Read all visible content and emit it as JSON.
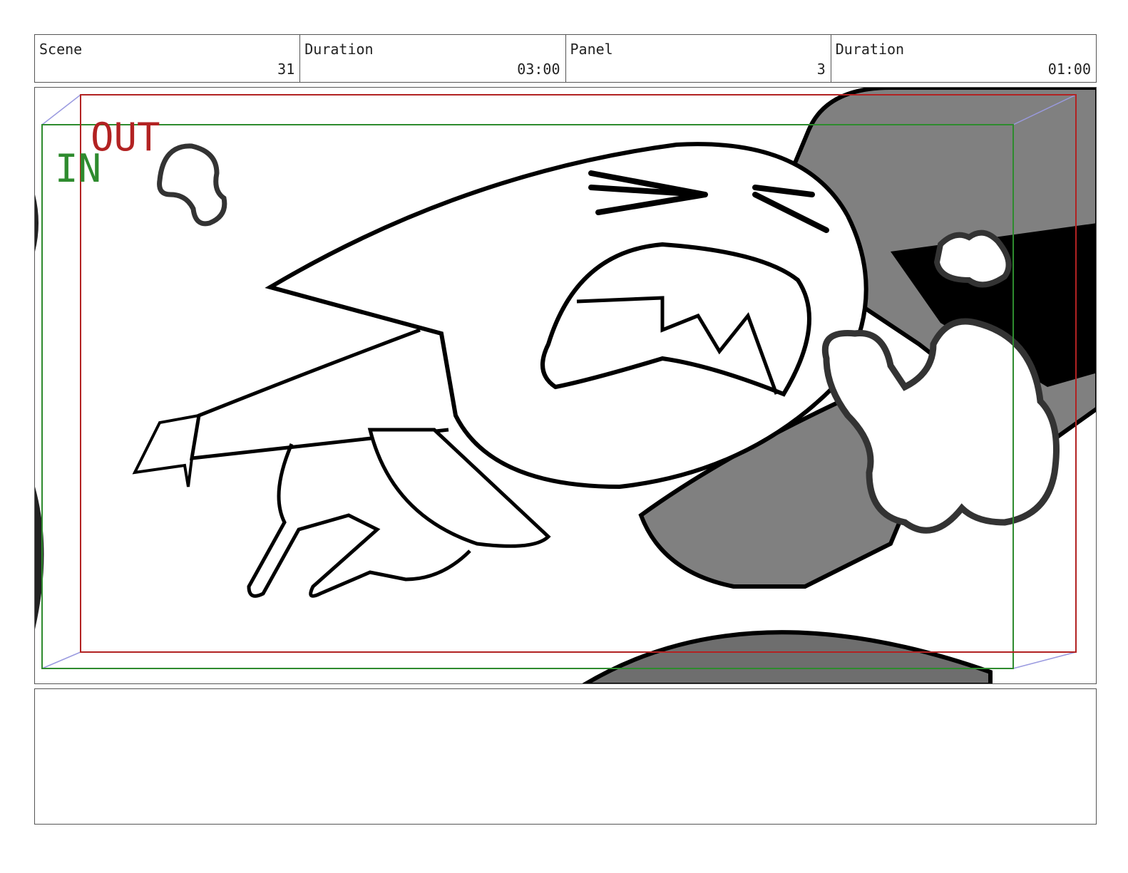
{
  "header": {
    "scene": {
      "label": "Scene",
      "value": "31"
    },
    "scene_duration": {
      "label": "Duration",
      "value": "03:00"
    },
    "panel": {
      "label": "Panel",
      "value": "3"
    },
    "panel_duration": {
      "label": "Duration",
      "value": "01:00"
    }
  },
  "panel": {
    "frame_in_label": "IN",
    "frame_out_label": "OUT",
    "colors": {
      "in_frame": "#2e8b2e",
      "out_frame": "#b22222",
      "shade": "#808080",
      "ink": "#000000",
      "arrow": "#9a9ae0"
    }
  },
  "notes": {
    "text": ""
  }
}
